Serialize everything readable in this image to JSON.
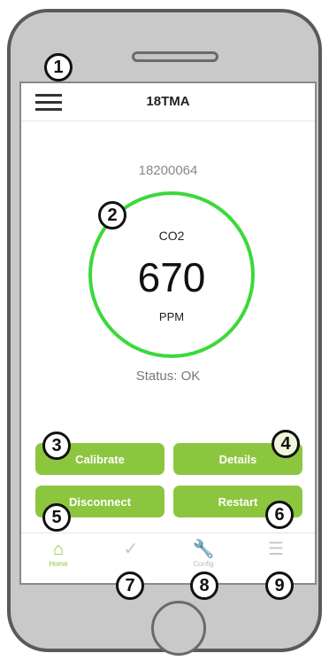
{
  "header": {
    "title": "18TMA"
  },
  "device": {
    "serial": "18200064"
  },
  "gauge": {
    "gas": "CO2",
    "value": "670",
    "unit": "PPM",
    "ring_color": "#3ad93a"
  },
  "status": {
    "text": "Status: OK"
  },
  "buttons": {
    "calibrate": "Calibrate",
    "details": "Details",
    "disconnect": "Disconnect",
    "restart": "Restart",
    "color": "#8cc63f"
  },
  "tabs": [
    {
      "icon": "home-icon",
      "label": "Home",
      "active": true
    },
    {
      "icon": "check-icon",
      "label": "",
      "active": false
    },
    {
      "icon": "wrench-icon",
      "label": "Config",
      "active": false
    },
    {
      "icon": "list-icon",
      "label": "",
      "active": false
    }
  ],
  "callouts": [
    "1",
    "2",
    "3",
    "4",
    "5",
    "6",
    "7",
    "8",
    "9"
  ]
}
